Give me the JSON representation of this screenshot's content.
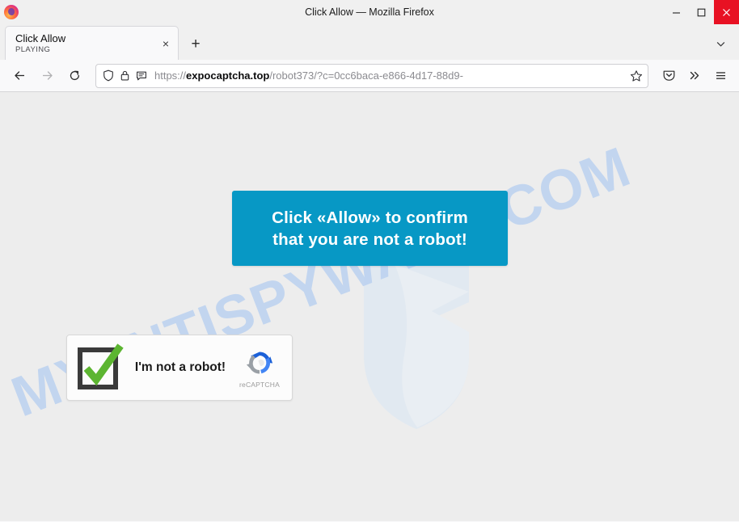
{
  "window": {
    "title": "Click Allow — Mozilla Firefox",
    "minimize_label": "Minimize",
    "maximize_label": "Maximize",
    "close_label": "Close"
  },
  "tabs": {
    "items": [
      {
        "title": "Click Allow",
        "status": "PLAYING",
        "close_label": "×"
      }
    ],
    "new_tab_label": "+",
    "list_all_tabs_label": "List all tabs"
  },
  "toolbar": {
    "back_label": "Back",
    "forward_label": "Forward",
    "reload_label": "Reload",
    "pocket_label": "Save to Pocket",
    "overflow_label": "More tools",
    "menu_label": "Open application menu"
  },
  "urlbar": {
    "scheme": "https://",
    "host": "expocaptcha.top",
    "path": "/robot373/?c=0cc6baca-e866-4d17-88d9-",
    "full_url": "https://expocaptcha.top/robot373/?c=0cc6baca-e866-4d17-88d9-",
    "shield_label": "Tracking protection",
    "lock_label": "Connection secure",
    "permissions_label": "Site permissions",
    "bookmark_label": "Bookmark this page"
  },
  "page": {
    "banner": {
      "line1": "Click «Allow» to confirm",
      "line2": "that you are not a robot!",
      "background_color": "#0798c5",
      "text_color": "#ffffff"
    },
    "captcha": {
      "label": "I'm not a robot!",
      "brand": "reCAPTCHA",
      "checkmark_color": "#5cb531",
      "box_color": "#3a3a3a"
    },
    "watermark": {
      "text": "MYANTISPYWARE.COM",
      "color": "#b9d0f0"
    },
    "background_color": "#ededed"
  }
}
